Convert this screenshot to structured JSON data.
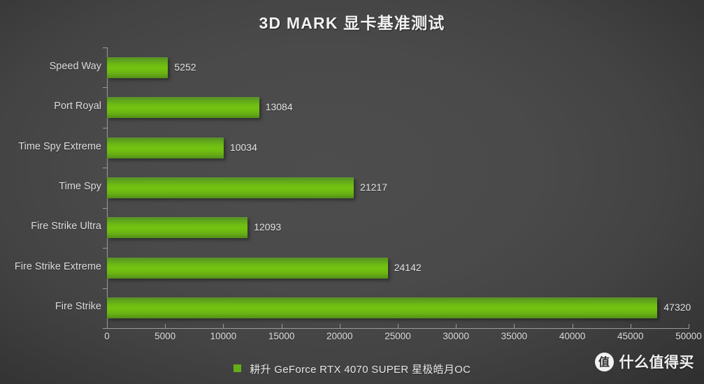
{
  "chart_data": {
    "type": "bar",
    "orientation": "horizontal",
    "title": "3D MARK 显卡基准测试",
    "xlabel": "",
    "ylabel": "",
    "categories": [
      "Speed Way",
      "Port Royal",
      "Time Spy Extreme",
      "Time Spy",
      "Fire Strike Ultra",
      "Fire Strike Extreme",
      "Fire Strike"
    ],
    "values": [
      5252,
      13084,
      10034,
      21217,
      12093,
      24142,
      47320
    ],
    "value_labels": [
      "5252",
      "13084",
      "10034",
      "21217",
      "12093",
      "24142",
      "47320"
    ],
    "series": [
      {
        "name": "耕升 GeForce RTX 4070 SUPER 星极皓月OC",
        "values": [
          5252,
          13084,
          10034,
          21217,
          12093,
          24142,
          47320
        ],
        "color": "#6fbd12"
      }
    ],
    "xlim": [
      0,
      50000
    ],
    "xticks": [
      0,
      5000,
      10000,
      15000,
      20000,
      25000,
      30000,
      35000,
      40000,
      45000,
      50000
    ],
    "xtick_labels": [
      "0",
      "5000",
      "10000",
      "15000",
      "20000",
      "25000",
      "30000",
      "35000",
      "40000",
      "45000",
      "50000"
    ],
    "grid": false,
    "legend_position": "bottom"
  },
  "legend": {
    "label": "耕升 GeForce RTX 4070 SUPER 星极皓月OC",
    "swatch_color": "#64ad17"
  },
  "watermark": {
    "badge": "值",
    "text": "什么值得买"
  },
  "colors": {
    "background": "#4a4a4a",
    "bar_green": "#6fbd12",
    "bar_green_dark": "#4f8a1c",
    "axis": "#9a9a9a",
    "text": "#dedede",
    "title_text": "#f2f2f2"
  }
}
